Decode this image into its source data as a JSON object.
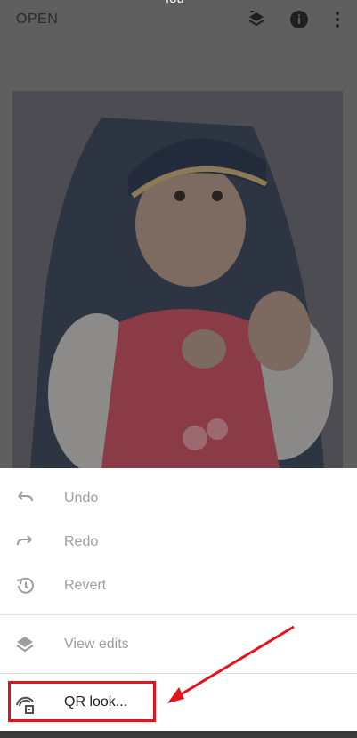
{
  "topbar": {
    "open_label": "OPEN",
    "title_partial": "fou",
    "icons": [
      "layers-stack-icon",
      "info-icon",
      "more-vert-icon"
    ]
  },
  "image": {
    "subject": "photo"
  },
  "menu": {
    "items": [
      {
        "label": "Undo",
        "icon": "undo-icon"
      },
      {
        "label": "Redo",
        "icon": "redo-icon"
      },
      {
        "label": "Revert",
        "icon": "history-icon"
      },
      {
        "label": "View edits",
        "icon": "layers-icon"
      },
      {
        "label": "QR look...",
        "icon": "qr-look-icon"
      }
    ]
  },
  "colors": {
    "overlay": "#5f5f5f",
    "annotation": "#e3141b",
    "disabled_text": "#9e9e9e"
  }
}
